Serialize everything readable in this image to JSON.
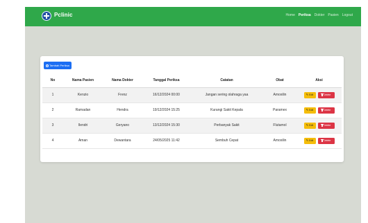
{
  "navbar": {
    "brand": "Pclinic",
    "links": [
      {
        "label": "Home",
        "active": false
      },
      {
        "label": "Periksa",
        "active": true
      },
      {
        "label": "Dokter",
        "active": false
      },
      {
        "label": "Pasien",
        "active": false
      },
      {
        "label": "Logout",
        "active": false
      }
    ]
  },
  "toolbar": {
    "add_label": "Tambah Periksa"
  },
  "table": {
    "headers": [
      "No",
      "Nama Pasien",
      "Nama Dokter",
      "Tanggal Periksa",
      "Catatan",
      "Obat",
      "Aksi"
    ],
    "rows": [
      [
        "1",
        "Kenzio",
        "Frenz",
        "16/12/2024 00:00",
        "Jangan sering olahraga yaa",
        "Amoxilin"
      ],
      [
        "2",
        "Ramadan",
        "Hendra",
        "19/12/2024 15:25",
        "Kurangi Sakit Kepala",
        "Paramex"
      ],
      [
        "3",
        "Ilendri",
        "Geryano",
        "13/12/2024 15:30",
        "Perbanyak Sakit",
        "Flutamol"
      ],
      [
        "4",
        "Aman",
        "Dewantara",
        "24/05/2025 11:42",
        "Sembuh Cepat",
        "Amoxilin"
      ]
    ],
    "edit_label": "Edit",
    "delete_label": "Delete"
  },
  "colors": {
    "navbar": "#2fa84a",
    "add_button": "#1b6ef3",
    "edit_button": "#f5bd0a",
    "delete_button": "#dc3545",
    "background": "#d7dad3"
  }
}
